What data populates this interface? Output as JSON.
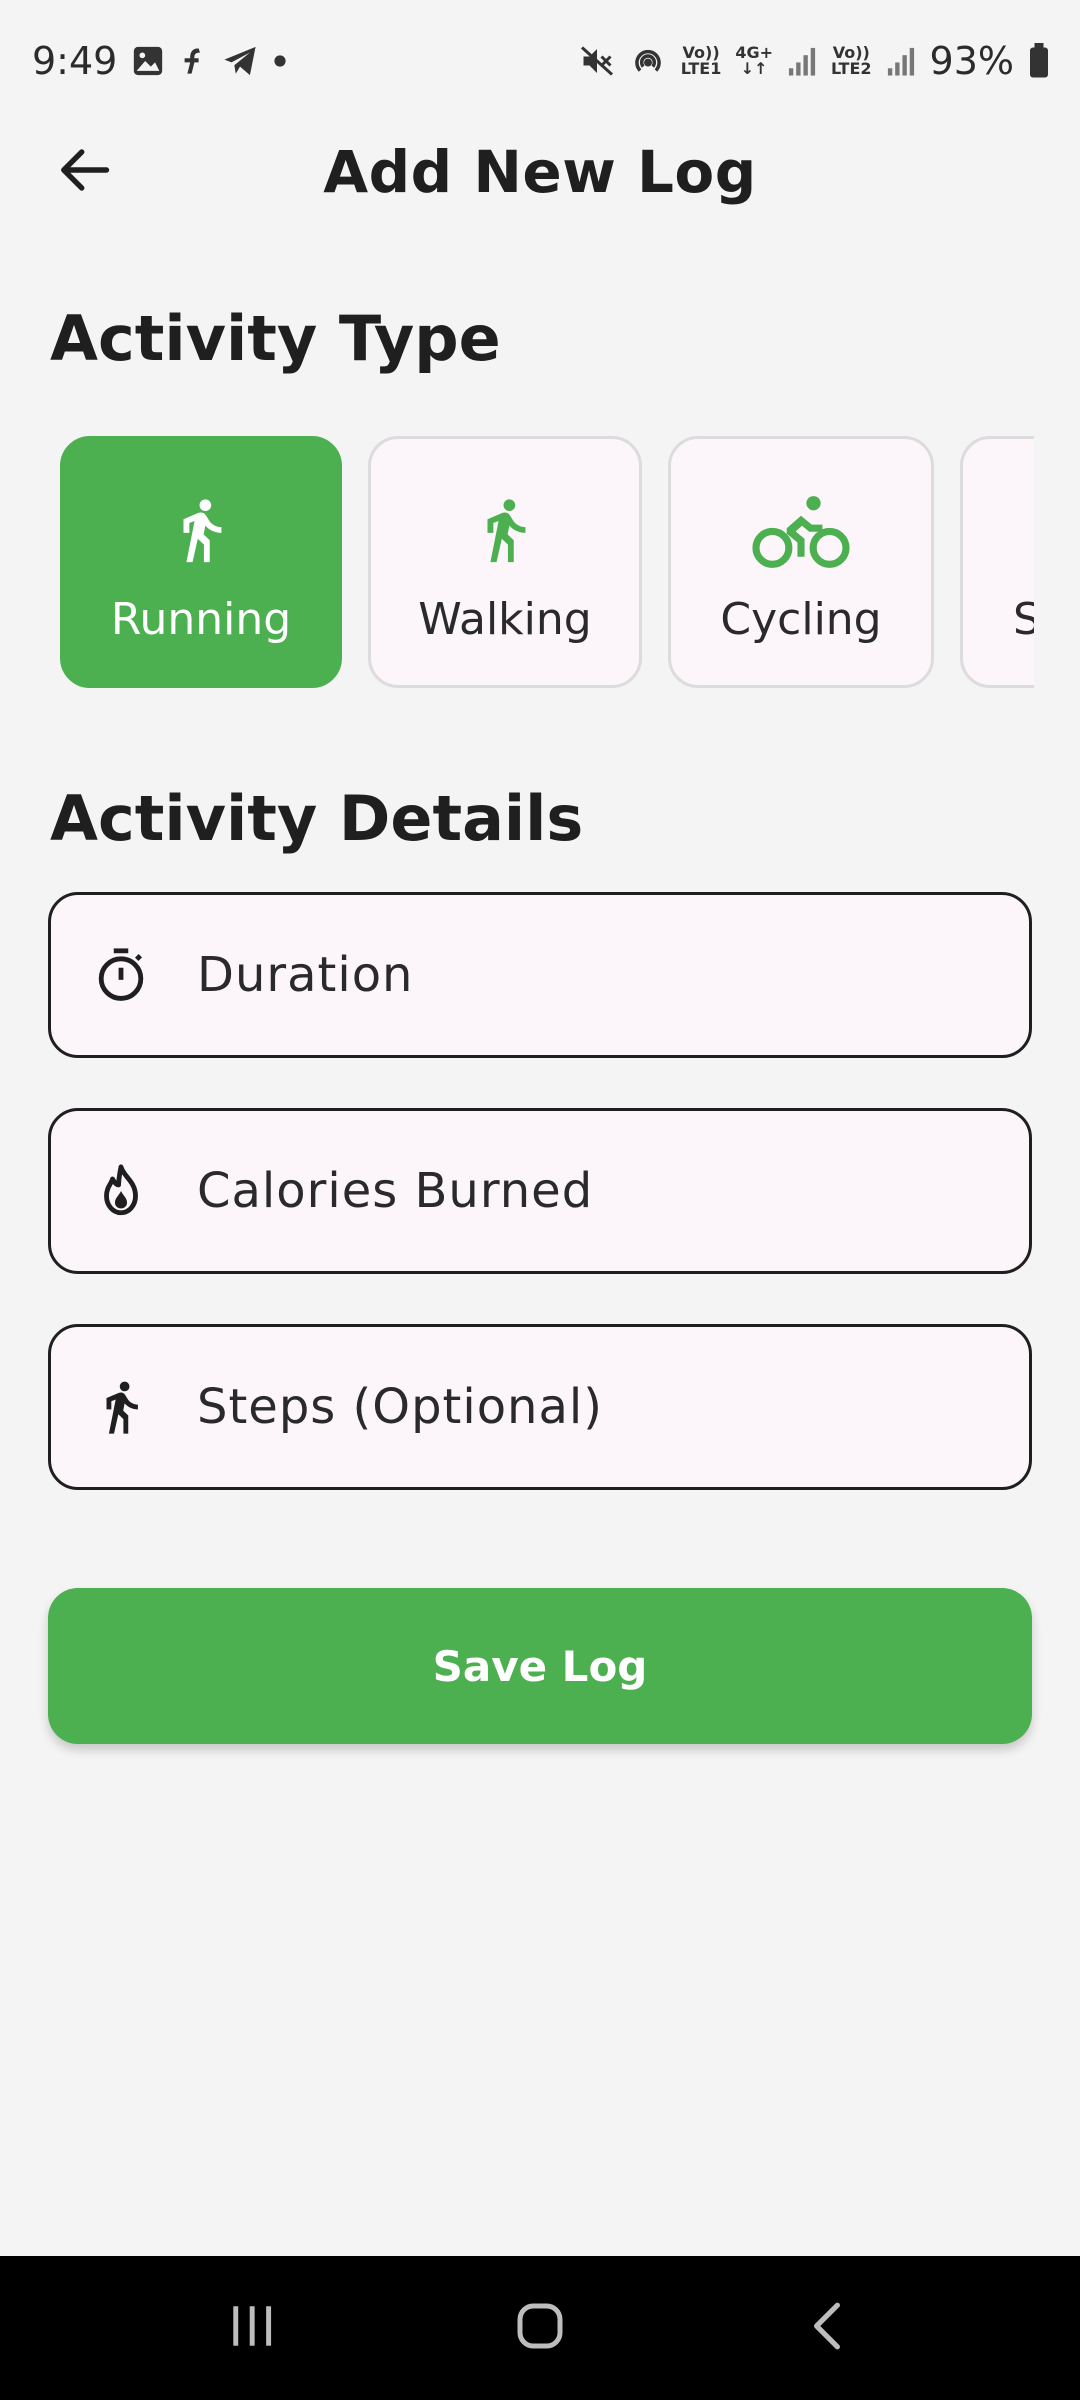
{
  "status_bar": {
    "time": "9:49",
    "battery_text": "93%",
    "sim1_label_top": "Vo))",
    "sim1_label_bottom": "LTE1",
    "net_label": "4G+",
    "sim2_label_top": "Vo))",
    "sim2_label_bottom": "LTE2",
    "icons": [
      "image-icon",
      "app-notification-icon",
      "telegram-icon",
      "dot-icon",
      "mute-icon",
      "hotspot-icon",
      "signal-icon",
      "signal-icon",
      "battery-icon"
    ]
  },
  "app_bar": {
    "title": "Add New Log",
    "back_icon": "arrow-left-icon"
  },
  "activity_type": {
    "title": "Activity Type",
    "selected_index": 0,
    "options": [
      {
        "label": "Running",
        "icon": "running-icon"
      },
      {
        "label": "Walking",
        "icon": "walking-icon"
      },
      {
        "label": "Cycling",
        "icon": "cycling-icon"
      },
      {
        "label": "S",
        "icon": ""
      }
    ]
  },
  "activity_details": {
    "title": "Activity Details",
    "fields": [
      {
        "placeholder": "Duration",
        "value": "",
        "icon": "timer-icon"
      },
      {
        "placeholder": "Calories Burned",
        "value": "",
        "icon": "fire-icon"
      },
      {
        "placeholder": "Steps (Optional)",
        "value": "",
        "icon": "walking-icon"
      }
    ]
  },
  "save_button": {
    "label": "Save Log"
  },
  "colors": {
    "accent": "#4caf50",
    "background": "#f4f4f4",
    "field_bg": "#fcf6fb",
    "text": "#1f1f1f"
  },
  "nav_bar": {
    "icons": [
      "recents-icon",
      "home-icon",
      "back-nav-icon"
    ]
  }
}
